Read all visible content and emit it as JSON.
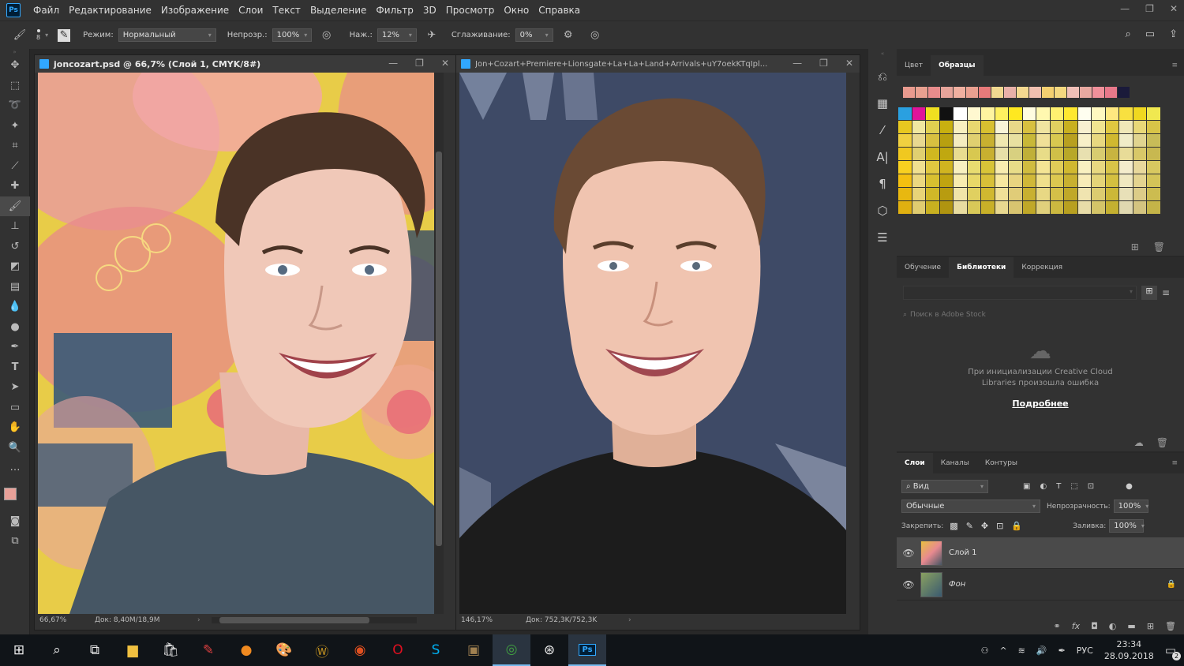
{
  "menubar": {
    "logo": "Ps",
    "items": [
      "Файл",
      "Редактирование",
      "Изображение",
      "Слои",
      "Текст",
      "Выделение",
      "Фильтр",
      "3D",
      "Просмотр",
      "Окно",
      "Справка"
    ]
  },
  "options": {
    "brush_size": "8",
    "mode_label": "Режим:",
    "mode_value": "Нормальный",
    "opacity_label": "Непрозр.:",
    "opacity_value": "100%",
    "pressure_label": "Наж.:",
    "pressure_value": "12%",
    "smoothing_label": "Сглаживание:",
    "smoothing_value": "0%"
  },
  "doc1": {
    "title": "joncozart.psd @ 66,7% (Слой 1, CMYK/8#)",
    "zoom": "66,67%",
    "docsize": "Док: 8,40M/18,9M"
  },
  "doc2": {
    "title": "Jon+Cozart+Premiere+Lionsgate+La+La+Land+Arrivals+uY7oekKTqIpl...",
    "zoom": "146,17%",
    "docsize": "Док: 752,3K/752,3K"
  },
  "swatch_panel": {
    "tabs": [
      "Цвет",
      "Образцы"
    ],
    "recent": [
      "#e89a8e",
      "#e8a090",
      "#e88c8c",
      "#e6a49a",
      "#f0b0a0",
      "#eaa090",
      "#e87a7a",
      "#f0d890",
      "#e8b0a8",
      "#f4d890",
      "#f0c0b0",
      "#f4d070",
      "#f4d880",
      "#f0c0b8",
      "#e8a8a0",
      "#f0909a",
      "#e8788a",
      "#1a1a3a"
    ],
    "grid": [
      [
        "#2aa0e0",
        "#e0149a",
        "#f0e020",
        "#111111",
        "#ffffff",
        "#fff8d0",
        "#fff4a0",
        "#fff060",
        "#ffe820",
        "#fffce0",
        "#fff8b0",
        "#fff070",
        "#ffe830",
        "#fffef0",
        "#fff8c0",
        "#ffe880",
        "#f8e040",
        "#f0d820",
        "#f0e850"
      ],
      [
        "#e8c820",
        "#f0e8a0",
        "#e0d050",
        "#c8b010",
        "#f8f0c0",
        "#e8d870",
        "#d8c030",
        "#f8f4d8",
        "#e8d888",
        "#d8c040",
        "#f0e4a0",
        "#e0d060",
        "#c8b020",
        "#f8f0d0",
        "#f0e490",
        "#e0c840",
        "#f0e8b8",
        "#e8d878",
        "#d8c448"
      ],
      [
        "#f0d040",
        "#e8d890",
        "#d8c040",
        "#b8a010",
        "#f4ecc0",
        "#e0d070",
        "#c8b030",
        "#f0e8b0",
        "#e8e0a0",
        "#c8b838",
        "#f0e098",
        "#d8c850",
        "#b8a020",
        "#f8f0c8",
        "#e8d880",
        "#d0b830",
        "#f0ecc8",
        "#e0d490",
        "#c8bc58"
      ],
      [
        "#f0c820",
        "#e0d070",
        "#d0b820",
        "#c0a810",
        "#e8dc90",
        "#d8c850",
        "#c8b030",
        "#e8e0a8",
        "#d8d080",
        "#c0b038",
        "#e8dc88",
        "#d0c048",
        "#b8a828",
        "#e8e0b0",
        "#d8cc70",
        "#c8b440",
        "#e8dc98",
        "#d8c868",
        "#c8b850"
      ],
      [
        "#f8d020",
        "#f0e090",
        "#e0c840",
        "#d0b420",
        "#f8f0c0",
        "#e8dc70",
        "#d8c438",
        "#f8ecb0",
        "#e8dc88",
        "#d0bc40",
        "#f4e494",
        "#e0cc58",
        "#d0b830",
        "#f8f0c0",
        "#e8d880",
        "#d8c448",
        "#f4eccc",
        "#e8d89c",
        "#d8c860"
      ],
      [
        "#f4c010",
        "#ecd880",
        "#d8c030",
        "#c0a410",
        "#f8ecb0",
        "#e8d868",
        "#d8c038",
        "#f8e8a0",
        "#e8d480",
        "#d0b838",
        "#f0e08c",
        "#dcc850",
        "#c8b030",
        "#f8ecb8",
        "#e4d478",
        "#d4c040",
        "#f0e8c0",
        "#e4d490",
        "#d4c458"
      ],
      [
        "#e8b810",
        "#e8d478",
        "#d0b828",
        "#b89c10",
        "#f0e4a8",
        "#e0d060",
        "#d0b830",
        "#f0e098",
        "#e0cc78",
        "#c8b030",
        "#e8d884",
        "#d4c048",
        "#c0a828",
        "#f0e4b0",
        "#dccc70",
        "#ccb838",
        "#e8e0b8",
        "#dccc88",
        "#ccbc50"
      ],
      [
        "#e0b010",
        "#e0cc70",
        "#c8b020",
        "#b09410",
        "#e8dca0",
        "#d8c858",
        "#c8b028",
        "#e8d890",
        "#d8c470",
        "#c0a828",
        "#e0d07c",
        "#ccb840",
        "#b8a020",
        "#e8dca8",
        "#d4c468",
        "#c4b030",
        "#e0d8b0",
        "#d4c480",
        "#c4b448"
      ]
    ]
  },
  "library_panel": {
    "tabs": [
      "Обучение",
      "Библиотеки",
      "Коррекция"
    ],
    "search_placeholder": "Поиск в Adobe Stock",
    "error_msg": "При инициализации Creative Cloud Libraries произошла ошибка",
    "more_link": "Подробнее"
  },
  "layers_panel": {
    "tabs": [
      "Слои",
      "Каналы",
      "Контуры"
    ],
    "filter_label": "Вид",
    "blend_mode": "Обычные",
    "opacity_label": "Непрозрачность:",
    "opacity_value": "100%",
    "lock_label": "Закрепить:",
    "fill_label": "Заливка:",
    "fill_value": "100%",
    "layers": [
      {
        "name": "Слой 1"
      },
      {
        "name": "Фон"
      }
    ]
  },
  "taskbar": {
    "lang": "РУС",
    "time": "23:34",
    "date": "28.09.2018",
    "notif_count": "2"
  },
  "colors": {
    "fg": "#e8a098",
    "bg": "#ffffff",
    "accent": "#31a8ff"
  }
}
